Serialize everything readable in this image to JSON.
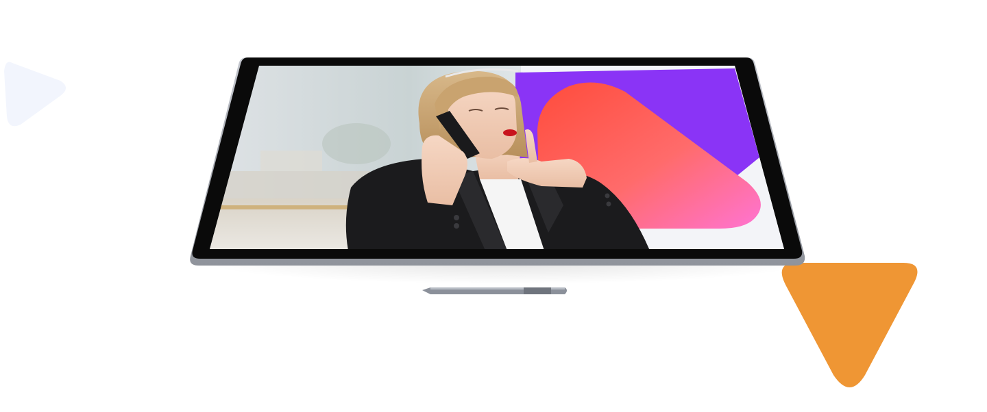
{
  "decorations": {
    "left_triangle": {
      "shape": "rounded-triangle-right",
      "color": "#f2f5fd"
    },
    "right_triangle": {
      "shape": "rounded-triangle-down",
      "color": "#ef9634"
    }
  },
  "device": {
    "type": "tablet",
    "bezel_color": "#0a0a0a",
    "frame_color": "#a9acb4"
  },
  "screen": {
    "image_subject": "woman-on-phone",
    "shapes": [
      {
        "name": "purple-block",
        "color": "#8a34f6"
      },
      {
        "name": "coral-gradient-blob",
        "colors": [
          "#ff4c3c",
          "#ff74d2"
        ]
      }
    ]
  },
  "stylus": {
    "color": "#8b909a"
  }
}
